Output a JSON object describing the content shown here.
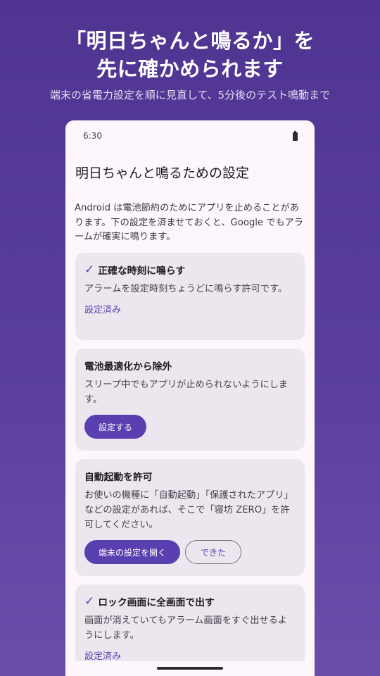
{
  "hero": {
    "title_line1": "「明日ちゃんと鳴るか」を",
    "title_line2": "先に確かめられます",
    "subtitle": "端末の省電力設定を順に見直して、5分後のテスト鳴動まで"
  },
  "status_bar": {
    "time": "6:30",
    "battery_icon": "battery-icon"
  },
  "screen": {
    "title": "明日ちゃんと鳴るための設定",
    "intro": "Android は電池節約のためにアプリを止めることがあります。下の設定を済ませておくと、Google でもアラームが確実に鳴ります。"
  },
  "cards": [
    {
      "title": "正確な時刻に鳴らす",
      "done": true,
      "check_icon": "✓",
      "description": "アラームを設定時刻ちょうどに鳴らす許可です。",
      "status": "設定済み"
    },
    {
      "title": "電池最適化から除外",
      "done": false,
      "description": "スリープ中でもアプリが止められないようにします。",
      "button": "設定する"
    },
    {
      "title": "自動起動を許可",
      "done": false,
      "description": "お使いの機種に「自動起動」「保護されたアプリ」などの設定があれば、そこで「寝坊 ZERO」を許可してください。",
      "button_primary": "端末の設定を開く",
      "button_secondary": "できた"
    },
    {
      "title": "ロック画面に全画面で出す",
      "done": true,
      "check_icon": "✓",
      "description": "画面が消えていてもアラーム画面をすぐ出せるようにします。",
      "status": "設定済み"
    }
  ],
  "colors": {
    "background": "#5a3f9d",
    "accent": "#5a3fb0",
    "card": "#ece6ee",
    "screen": "#fdf7fd"
  }
}
